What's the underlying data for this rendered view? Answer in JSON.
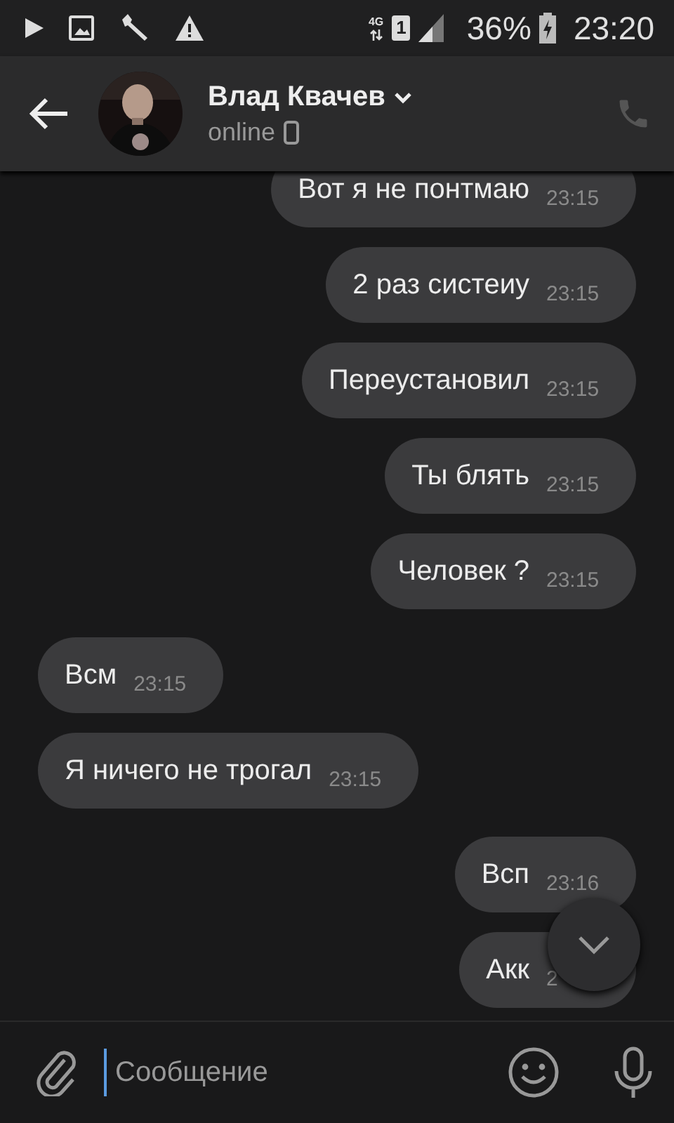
{
  "status_bar": {
    "battery": "36%",
    "time": "23:20",
    "network": "4G",
    "sim": "1"
  },
  "header": {
    "name": "Влад Квачев",
    "status": "online"
  },
  "messages": [
    {
      "kind": "out",
      "text": "Вот я не понтмаю",
      "time": "23:15"
    },
    {
      "kind": "out",
      "text": "2 раз систеиу",
      "time": "23:15"
    },
    {
      "kind": "out",
      "text": "Переустановил",
      "time": "23:15"
    },
    {
      "kind": "out",
      "text": "Ты блять",
      "time": "23:15"
    },
    {
      "kind": "out",
      "text": "Человек ?",
      "time": "23:15"
    },
    {
      "kind": "in",
      "text": "Всм",
      "time": "23:15"
    },
    {
      "kind": "in",
      "text": "Я ничего не трогал",
      "time": "23:15"
    },
    {
      "kind": "out",
      "text": "Всп",
      "time": "23:16"
    },
    {
      "kind": "out",
      "text": "Акк",
      "time": "2"
    }
  ],
  "composer": {
    "placeholder": "Сообщение"
  }
}
